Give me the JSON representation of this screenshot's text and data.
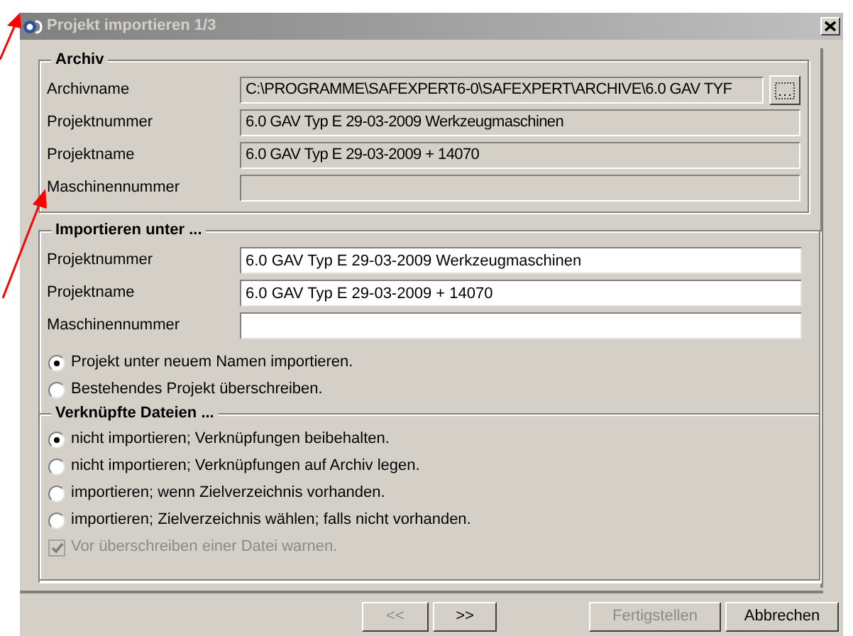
{
  "window": {
    "title": "Projekt importieren 1/3"
  },
  "archive": {
    "title": "Archiv",
    "fields": [
      {
        "label": "Archivname",
        "value": "C:\\PROGRAMME\\SAFEXPERT6-0\\SAFEXPERT\\ARCHIVE\\6.0 GAV TYF",
        "kind": "browse"
      },
      {
        "label": "Projektnummer",
        "value": "6.0 GAV Typ E 29-03-2009 Werkzeugmaschinen",
        "kind": "text"
      },
      {
        "label": "Projektname",
        "value": "6.0 GAV Typ E 29-03-2009 + 14070",
        "kind": "text"
      },
      {
        "label": "Maschinennummer",
        "kind": "text"
      }
    ]
  },
  "import_as": {
    "title": "Importieren unter ...",
    "fields": [
      {
        "label": "Projektnummer",
        "value": "6.0 GAV Typ E 29-03-2009 Werkzeugmaschinen"
      },
      {
        "label": "Projektname",
        "value": "6.0 GAV Typ E 29-03-2009 + 14070"
      },
      {
        "label": "Maschinennummer"
      }
    ],
    "options": [
      {
        "label": "Projekt unter neuem Namen importieren.",
        "selected": true
      },
      {
        "label": "Bestehendes Projekt überschreiben.",
        "selected": false
      }
    ]
  },
  "linked_files": {
    "title": "Verknüpfte Dateien ...",
    "options": [
      {
        "label": "nicht importieren; Verknüpfungen beibehalten.",
        "selected": true
      },
      {
        "label": "nicht importieren; Verknüpfungen auf Archiv legen.",
        "selected": false
      },
      {
        "label": "importieren; wenn Zielverzeichnis vorhanden.",
        "selected": false
      },
      {
        "label": "importieren; Zielverzeichnis wählen; falls nicht vorhanden.",
        "selected": false
      }
    ],
    "warn": {
      "label": "Vor überschreiben einer Datei warnen.",
      "checked": true,
      "disabled": true
    }
  },
  "buttons": [
    {
      "label": "<<",
      "disabled": true
    },
    {
      "label": ">>",
      "disabled": false
    },
    {
      "label": "Fertigstellen",
      "disabled": true
    },
    {
      "label": "Abbrechen",
      "disabled": false
    }
  ],
  "annotations": [
    {
      "kind": "arrow"
    },
    {
      "kind": "arrow"
    }
  ]
}
